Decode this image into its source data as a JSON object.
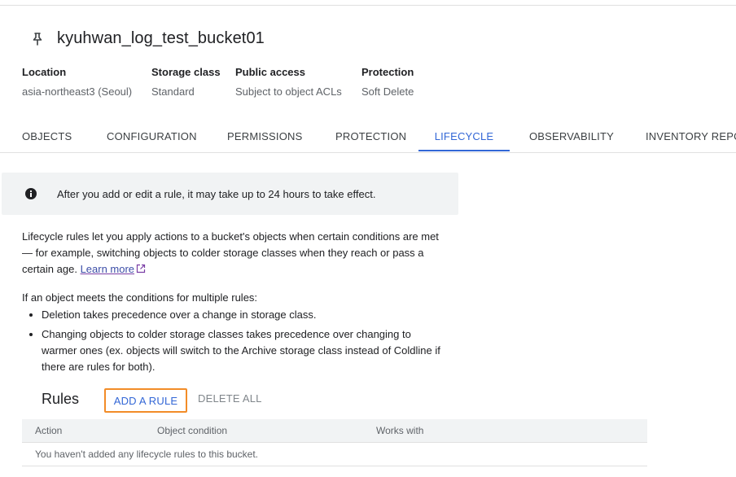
{
  "bucket": {
    "name": "kyuhwan_log_test_bucket01",
    "icon": "pin-icon"
  },
  "info": [
    {
      "label": "Location",
      "value": "asia-northeast3 (Seoul)"
    },
    {
      "label": "Storage class",
      "value": "Standard"
    },
    {
      "label": "Public access",
      "value": "Subject to object ACLs"
    },
    {
      "label": "Protection",
      "value": "Soft Delete"
    }
  ],
  "tabs": [
    {
      "label": "OBJECTS",
      "active": false
    },
    {
      "label": "CONFIGURATION",
      "active": false
    },
    {
      "label": "PERMISSIONS",
      "active": false
    },
    {
      "label": "PROTECTION",
      "active": false
    },
    {
      "label": "LIFECYCLE",
      "active": true
    },
    {
      "label": "OBSERVABILITY",
      "active": false
    },
    {
      "label": "INVENTORY REPORTS",
      "active": false
    }
  ],
  "banner": {
    "icon": "info-icon",
    "text": "After you add or edit a rule, it may take up to 24 hours to take effect."
  },
  "description": {
    "text": "Lifecycle rules let you apply actions to a bucket's objects when certain conditions are met — for example, switching objects to colder storage classes when they reach or pass a certain age.",
    "link_label": "Learn more",
    "link_icon": "external-link-icon"
  },
  "multi_rules": {
    "title": "If an object meets the conditions for multiple rules:",
    "bullets": [
      "Deletion takes precedence over a change in storage class.",
      "Changing objects to colder storage classes takes precedence over changing to warmer ones (ex. objects will switch to the Archive storage class instead of Coldline if there are rules for both)."
    ]
  },
  "rules": {
    "heading": "Rules",
    "add_label": "ADD A RULE",
    "delete_all_label": "DELETE ALL",
    "columns": [
      "Action",
      "Object condition",
      "Works with"
    ],
    "empty_message": "You haven't added any lifecycle rules to this bucket."
  },
  "colors": {
    "accent": "#3367d6",
    "focus_outline": "#f28c28",
    "banner_bg": "#f1f3f4",
    "muted_text": "#5f6368"
  }
}
